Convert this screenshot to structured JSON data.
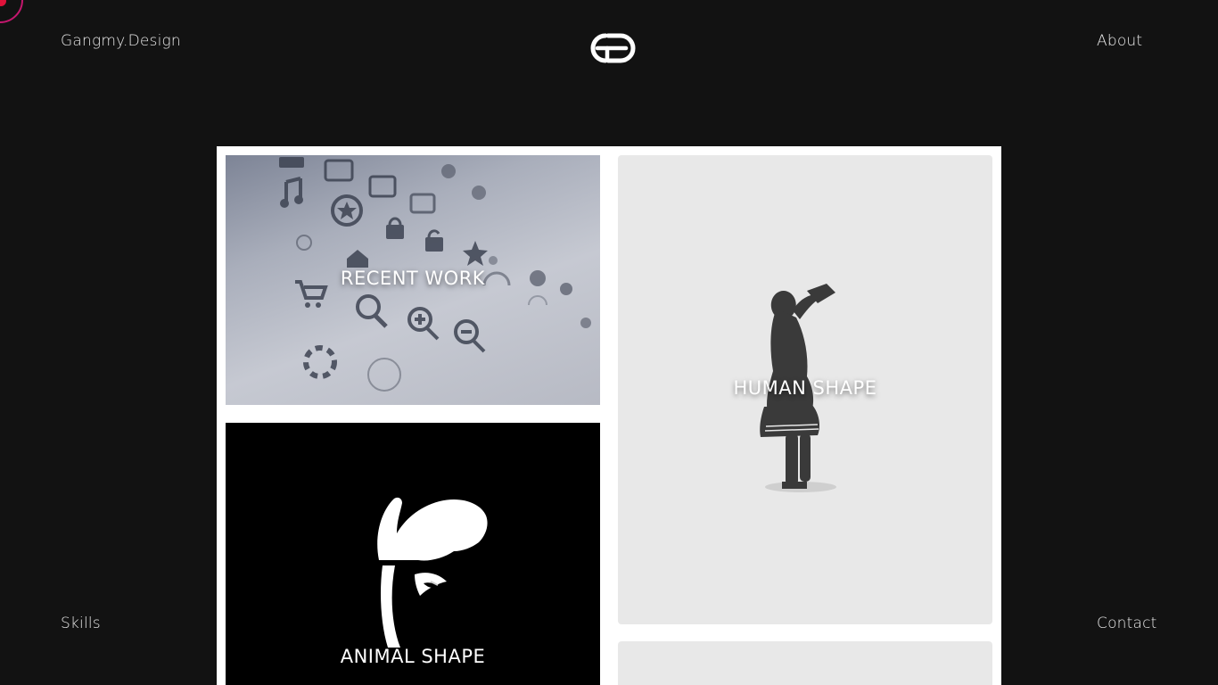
{
  "header": {
    "brand": "Gangmy.Design",
    "about": "About",
    "logo_icon": "gd-monogram-icon"
  },
  "footer": {
    "skills": "Skills",
    "contact": "Contact"
  },
  "gallery": {
    "tiles": [
      {
        "label": "RECENT WORK",
        "image": "icon-grid-photo"
      },
      {
        "label": "HUMAN SHAPE",
        "image": "human-silhouette-drinking"
      },
      {
        "label": "ANIMAL SHAPE",
        "image": "gorilla-silhouette"
      },
      {
        "label": "",
        "image": "partial-tile"
      }
    ]
  },
  "colors": {
    "background": "#121212",
    "text": "#e8e8e8",
    "frame": "#ffffff",
    "cursor_ring": "#c4176e",
    "cursor_dot": "#e0123a"
  }
}
